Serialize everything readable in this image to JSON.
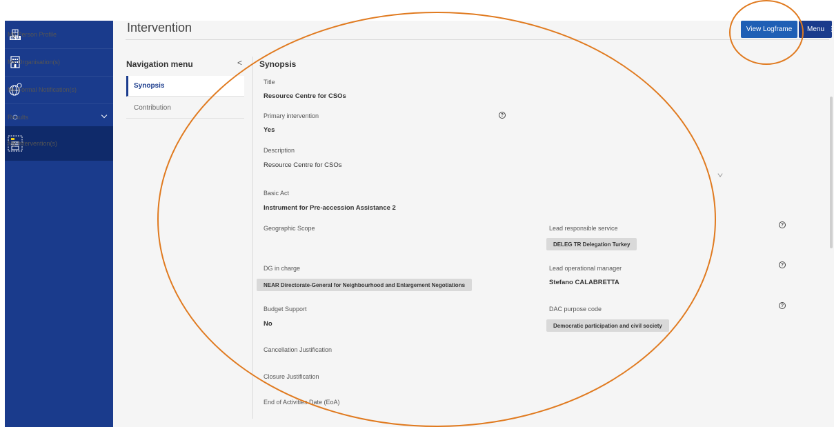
{
  "sidebar": {
    "items": [
      {
        "label": "My Person Profile",
        "icon": "beta-building-icon"
      },
      {
        "label": "My Organisation(s)",
        "icon": "building-icon"
      },
      {
        "label": "My Formal Notification(s)",
        "icon": "globe-icon"
      },
      {
        "label": "Results",
        "icon": "circle-icon"
      },
      {
        "label": "My Intervention(s)",
        "icon": "intervention-icon"
      }
    ],
    "beta_badge": "BETA"
  },
  "header": {
    "title": "Intervention",
    "view_logframe_label": "View Logframe",
    "menu_label": "Menu",
    "menu_dots": "⋮"
  },
  "nav": {
    "title": "Navigation menu",
    "collapse_glyph": "<",
    "items": [
      {
        "label": "Synopsis"
      },
      {
        "label": "Contribution"
      }
    ]
  },
  "synopsis": {
    "heading": "Synopsis",
    "title_label": "Title",
    "title_value": "Resource Centre for CSOs",
    "primary_label": "Primary intervention",
    "primary_value": "Yes",
    "description_label": "Description",
    "description_value": "Resource Centre for CSOs",
    "basic_act_label": "Basic Act",
    "basic_act_value": "Instrument for Pre-accession Assistance 2",
    "geo_label": "Geographic Scope",
    "lead_service_label": "Lead responsible service",
    "lead_service_value": "DELEG TR Delegation Turkey",
    "dg_label": "DG in charge",
    "dg_value": "NEAR Directorate-General for Neighbourhood and Enlargement Negotiations",
    "lead_manager_label": "Lead operational manager",
    "lead_manager_value": "Stefano CALABRETTA",
    "budget_label": "Budget Support",
    "budget_value": "No",
    "dac_label": "DAC purpose code",
    "dac_value": "Democratic participation and civil society",
    "cancel_label": "Cancellation Justification",
    "closure_label": "Closure Justification",
    "eoa_label": "End of Activities Date (EoA)",
    "help_glyph": "?"
  },
  "colors": {
    "sidebar": "#1a3b8c",
    "primary_button": "#1f5fb5",
    "annotation": "#e07a1f"
  }
}
